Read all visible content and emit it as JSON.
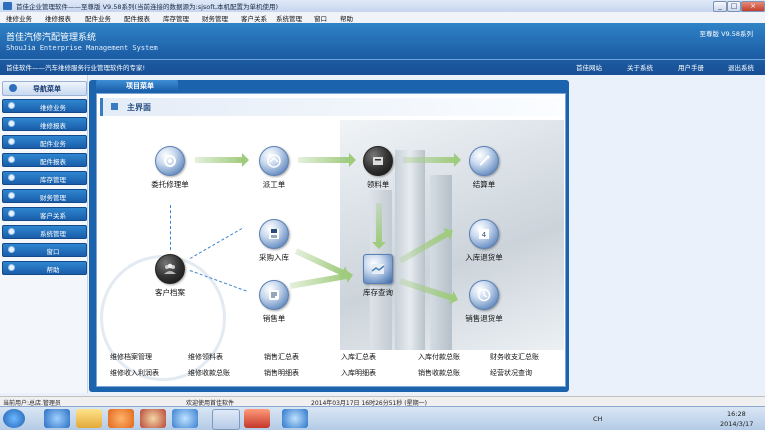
{
  "window": {
    "title": "首佳企业管理软件——至尊版  V9.58系列(当前连接的数据源为:sjsoft,本机配置为单机使用)",
    "controls": [
      "_",
      "□",
      "×"
    ]
  },
  "menubar": [
    "维修业务",
    "维修报表",
    "配件业务",
    "配件报表",
    "库存管理",
    "财务管理",
    "客户关系",
    "系统管理",
    "窗口",
    "帮助"
  ],
  "header": {
    "title": "首佳汽修汽配管理系统",
    "subtitle": "ShouJia Enterprise Management System",
    "slogan": "首佳软件——汽车维修服务行业管理软件的专家!",
    "version": "至尊版  V9.58系列",
    "links": [
      "首佳网站",
      "关于系统",
      "用户手册",
      "退出系统"
    ]
  },
  "sidebar": {
    "header": "导航菜单",
    "items": [
      "维修业务",
      "维修报表",
      "配件业务",
      "配件报表",
      "库存管理",
      "财务管理",
      "客户关系",
      "系统管理",
      "窗口",
      "帮助"
    ]
  },
  "panel": {
    "tab": "项目菜单",
    "heading": "主界面"
  },
  "nodes": {
    "weituo": "委托修理单",
    "paigong": "派工单",
    "lingliao": "领料单",
    "jiesuan": "结算单",
    "caigou": "采购入库",
    "kehu": "客户档案",
    "kucun": "库存查询",
    "rukutuihuo": "入库退货单",
    "xiaoshou": "销售单",
    "xiaoshoutuihuo": "销售退货单"
  },
  "reports": {
    "row1": [
      "维修档案管理",
      "维修领料表",
      "销售汇总表",
      "入库汇总表",
      "入库付款总账",
      "财务收支汇总账"
    ],
    "row2": [
      "维修收入利润表",
      "维修收款总账",
      "销售明细表",
      "入库明细表",
      "销售收款总账",
      "经营状况查询"
    ]
  },
  "statusbar": {
    "user": "当前用户:总店.管理员",
    "welcome": "欢迎使用首佳软件",
    "datetime": "2014年03月17日  16时26分51秒  (星期一)"
  },
  "taskbar": {
    "lang": "CH",
    "time": "16:28",
    "date": "2014/3/17"
  }
}
